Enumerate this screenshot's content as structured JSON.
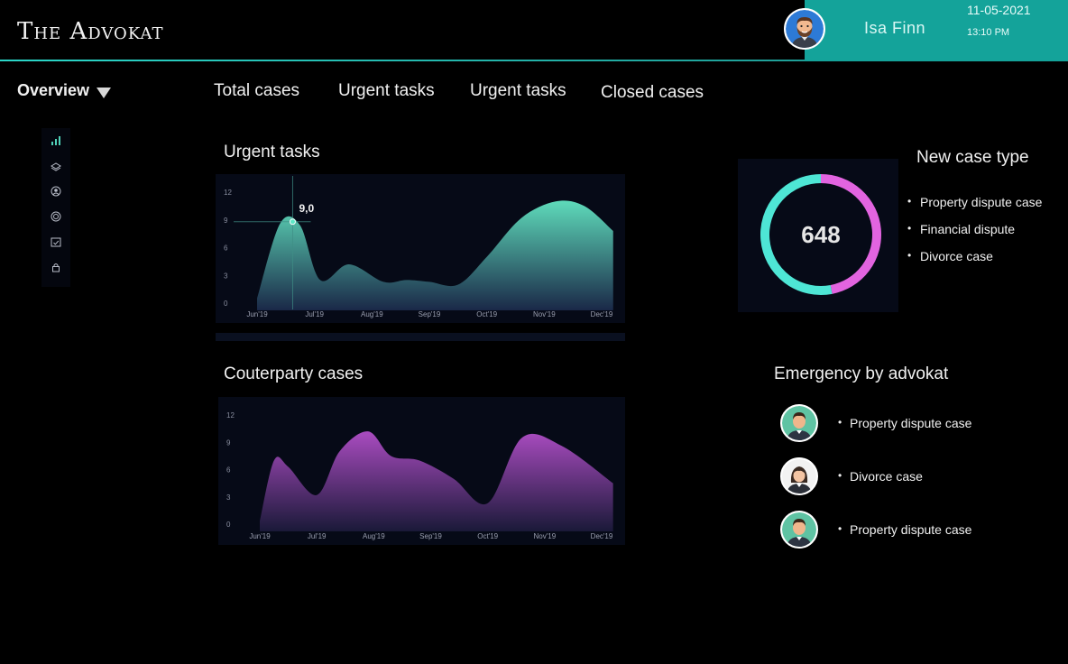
{
  "app": {
    "title": "The Advokat"
  },
  "user": {
    "name": "Isa  Finn",
    "date": "11-05-2021",
    "time": "13:10 PM"
  },
  "nav": {
    "overview": "Overview",
    "tabs": [
      "Total cases",
      "Urgent tasks",
      "Urgent tasks",
      "Closed cases"
    ]
  },
  "sidebar": {
    "icons": [
      "bar-chart-icon",
      "layers-icon",
      "user-circle-icon",
      "target-icon",
      "calendar-check-icon",
      "lock-icon"
    ]
  },
  "sections": {
    "urgent_tasks": "Urgent tasks",
    "counterparty": "Couterparty cases",
    "new_case_type": "New case type",
    "emergency": "Emergency by advokat"
  },
  "colors": {
    "accent": "#14a39a",
    "teal_chart": "#5de8c6",
    "purple_chart": "#a64fc0",
    "donut_teal": "#4ee6d5",
    "donut_pink": "#e264e0"
  },
  "chart_data": [
    {
      "type": "area",
      "categories": [
        "Jun'19",
        "Jul'19",
        "Aug'19",
        "Sep'19",
        "Oct'19",
        "Nov'19",
        "Dec'19"
      ],
      "x": [
        0,
        0.4,
        0.75,
        1.1,
        1.6,
        2.2,
        2.6,
        3.0,
        3.5,
        4.0,
        4.6,
        5.2,
        5.7,
        6.2
      ],
      "y": [
        0.5,
        8.6,
        8.4,
        2.5,
        4.2,
        2.3,
        2.5,
        2.3,
        2.0,
        5.0,
        9.2,
        11.0,
        10.5,
        7.8
      ],
      "yticks": [
        0,
        3,
        6,
        9,
        12
      ],
      "ylim": [
        0,
        12
      ],
      "annotation": {
        "label": "9,0"
      }
    },
    {
      "type": "area",
      "categories": [
        "Jun'19",
        "Jul'19",
        "Aug'19",
        "Sep'19",
        "Oct'19",
        "Nov'19",
        "Dec'19"
      ],
      "x": [
        0,
        0.25,
        0.5,
        1.0,
        1.4,
        1.9,
        2.3,
        2.8,
        3.4,
        4.0,
        4.6,
        5.3,
        6.2
      ],
      "y": [
        0.3,
        7.0,
        6.3,
        3.2,
        8.0,
        10.2,
        7.5,
        7.0,
        5.0,
        2.3,
        9.5,
        8.6,
        4.5
      ],
      "yticks": [
        0,
        3,
        6,
        9,
        12
      ],
      "ylim": [
        0,
        12
      ]
    },
    {
      "type": "pie",
      "center_value": "648",
      "slices": [
        {
          "name": "teal",
          "value": 53
        },
        {
          "name": "pink",
          "value": 47
        }
      ]
    }
  ],
  "new_case_types": [
    "Property dispute case",
    "Financial dispute",
    "Divorce case"
  ],
  "emergency": [
    {
      "label": "Property dispute case",
      "avatar": "male-avatar-icon"
    },
    {
      "label": "Divorce case",
      "avatar": "female-avatar-icon"
    },
    {
      "label": "Property dispute case",
      "avatar": "male-avatar-icon"
    }
  ]
}
